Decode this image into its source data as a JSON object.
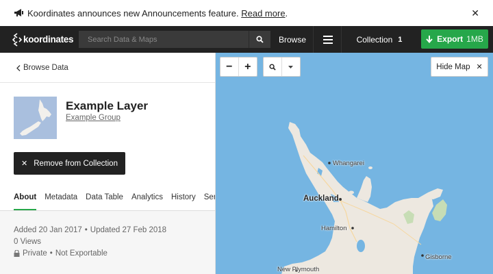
{
  "banner": {
    "text": "Koordinates announces new Announcements feature.",
    "link": "Read more",
    "suffix": ".",
    "close_icon": "close-icon"
  },
  "nav": {
    "logo_text": "koordinates",
    "search_placeholder": "Search Data & Maps",
    "browse_label": "Browse",
    "collection_label": "Collection",
    "collection_count": "1",
    "export_label": "Export",
    "export_size": "1MB",
    "export_color": "#26a74a"
  },
  "panel": {
    "breadcrumb": "Browse Data",
    "layer_title": "Example Layer",
    "layer_group": "Example Group",
    "remove_label": "Remove from Collection",
    "tabs": [
      {
        "label": "About",
        "active": true
      },
      {
        "label": "Metadata"
      },
      {
        "label": "Data Table"
      },
      {
        "label": "Analytics"
      },
      {
        "label": "History"
      },
      {
        "label": "Servi"
      }
    ],
    "added": "Added 20 Jan 2017",
    "updated": "Updated 27 Feb 2018",
    "views": "0 Views",
    "privacy": "Private",
    "exportable": "Not Exportable"
  },
  "map": {
    "hide_label": "Hide Map",
    "cities": {
      "whangarei": "Whangarei",
      "auckland": "Auckland",
      "hamilton": "Hamilton",
      "gisborne": "Gisborne",
      "new_plymouth": "New Plymouth"
    },
    "water_color": "#75b5e2",
    "land_color": "#ede8e0"
  }
}
